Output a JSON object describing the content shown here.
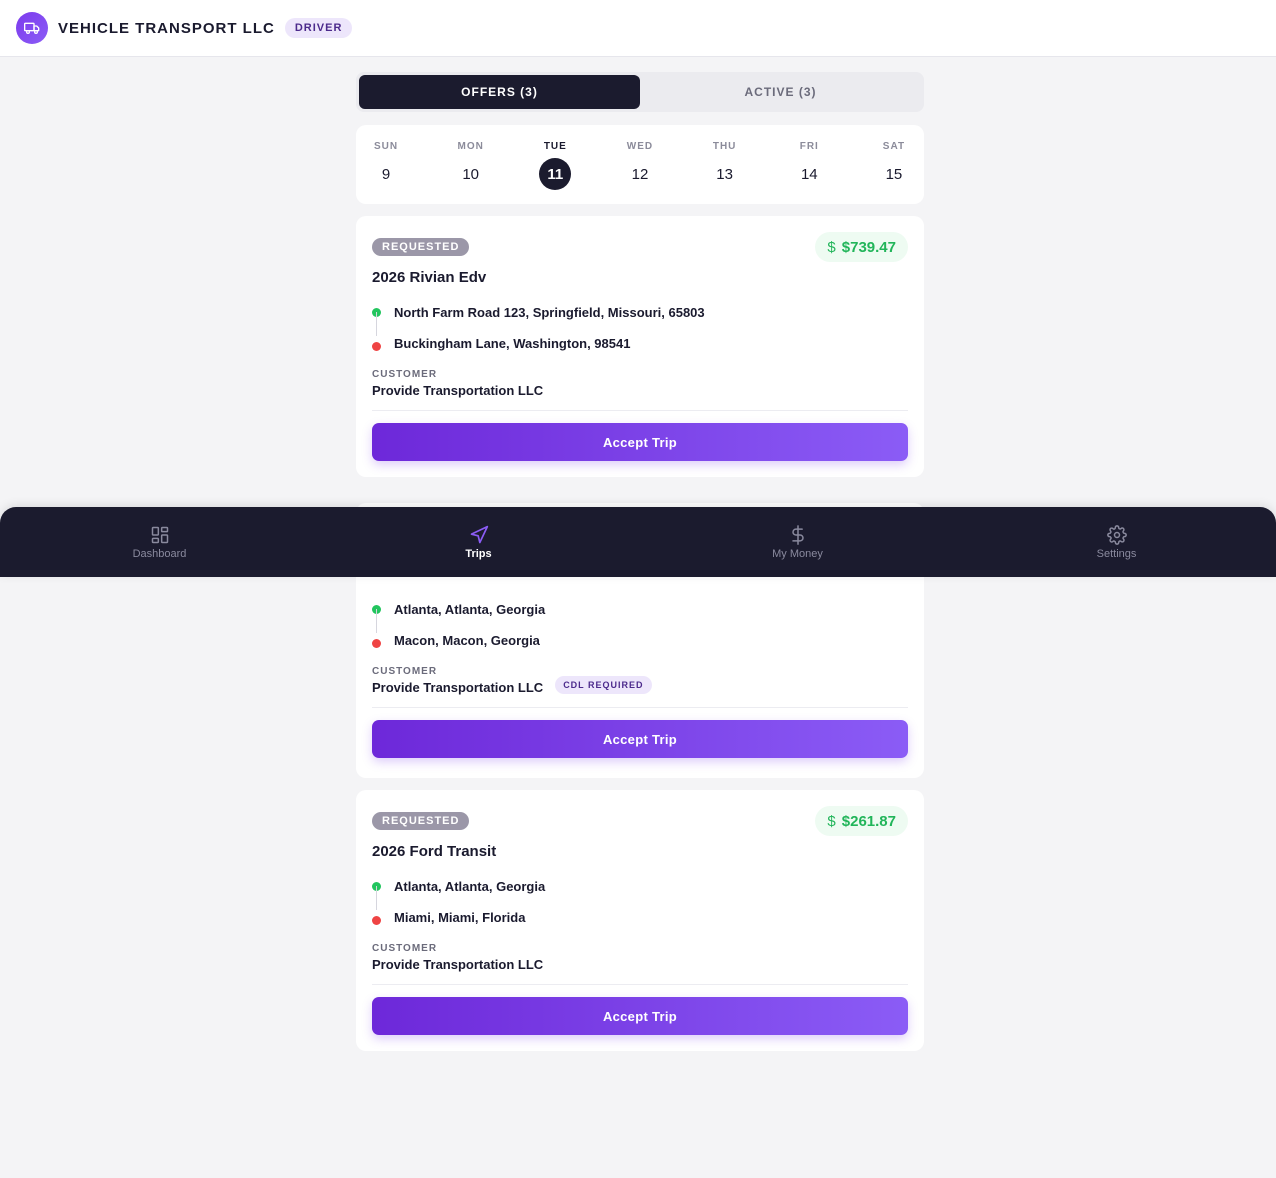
{
  "header": {
    "brand_title": "VEHICLE TRANSPORT LLC",
    "role_badge": "DRIVER"
  },
  "tabs": [
    {
      "label": "OFFERS (3)",
      "active": true
    },
    {
      "label": "ACTIVE (3)",
      "active": false
    }
  ],
  "calendar": {
    "days": [
      {
        "name": "SUN",
        "num": "9"
      },
      {
        "name": "MON",
        "num": "10"
      },
      {
        "name": "TUE",
        "num": "11",
        "selected": true
      },
      {
        "name": "WED",
        "num": "12"
      },
      {
        "name": "THU",
        "num": "13"
      },
      {
        "name": "FRI",
        "num": "14"
      },
      {
        "name": "SAT",
        "num": "15"
      }
    ]
  },
  "trips": [
    {
      "status": "REQUESTED",
      "price": "$739.47",
      "vehicle": "2026 Rivian Edv",
      "origin": "North Farm Road 123, Springfield, Missouri, 65803",
      "destination": "Buckingham Lane, Washington, 98541",
      "customer_label": "CUSTOMER",
      "customer": "Provide Transportation LLC",
      "action": "Accept Trip"
    },
    {
      "origin": "Atlanta, Atlanta, Georgia",
      "destination": "Macon, Macon, Georgia",
      "customer_label": "CUSTOMER",
      "customer": "Provide Transportation LLC",
      "badge": "CDL REQUIRED",
      "action": "Accept Trip"
    },
    {
      "status": "REQUESTED",
      "price": "$261.87",
      "vehicle": "2026 Ford Transit",
      "origin": "Atlanta, Atlanta, Georgia",
      "destination": "Miami, Miami, Florida",
      "customer_label": "CUSTOMER",
      "customer": "Provide Transportation LLC",
      "action": "Accept Trip"
    }
  ],
  "bottom_nav": [
    {
      "label": "Dashboard",
      "icon": "grid-icon"
    },
    {
      "label": "Trips",
      "icon": "navigation-icon",
      "active": true
    },
    {
      "label": "My Money",
      "icon": "dollar-icon"
    },
    {
      "label": "Settings",
      "icon": "gear-icon"
    }
  ],
  "colors": {
    "accent": "#7c3aed",
    "dark": "#1b1b2e",
    "price_green": "#22b55a",
    "origin_dot": "#22c55e",
    "destination_dot": "#ef4444"
  }
}
